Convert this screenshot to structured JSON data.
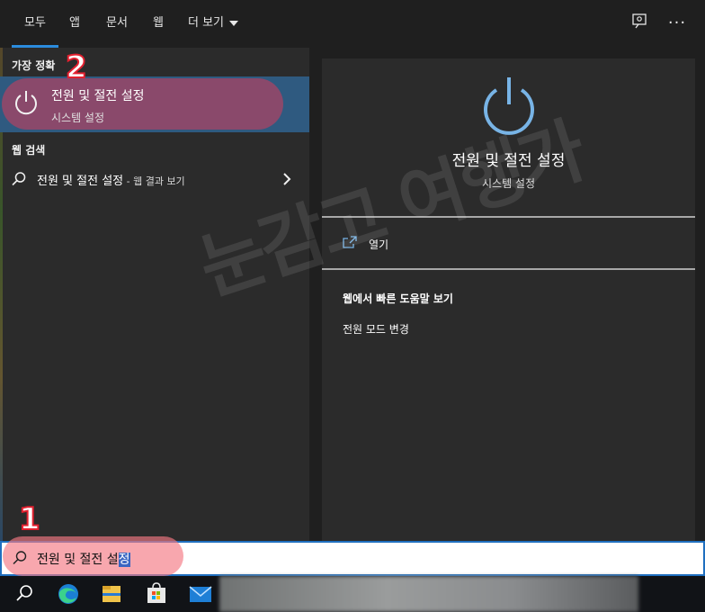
{
  "tabs": {
    "all": "모두",
    "apps": "앱",
    "documents": "문서",
    "web": "웹",
    "more": "더 보기"
  },
  "left": {
    "best_match_label": "가장 정확",
    "best_match": {
      "title": "전원 및 절전 설정",
      "subtitle": "시스템 설정"
    },
    "web_search_label": "웹 검색",
    "web_result": {
      "query": "전원 및 절전 설정",
      "suffix": " - 웹 결과 보기"
    }
  },
  "detail": {
    "title": "전원 및 절전 설정",
    "subtitle": "시스템 설정",
    "open_label": "열기",
    "help_heading": "웹에서 빠른 도움말 보기",
    "help_link": "전원 모드 변경"
  },
  "search": {
    "value_plain": "전원 및 절전 설",
    "value_selected": "정"
  },
  "annotations": {
    "badge_1": "1",
    "badge_2": "2"
  },
  "watermark": "눈감고 여행가",
  "colors": {
    "accent_blue": "#2b8bdc",
    "selection_row": "#2f5a80",
    "highlight_pink": "#d63c5a",
    "badge_red": "#e3202f",
    "power_icon_blue": "#78b4e6"
  },
  "icons": [
    "feedback-icon",
    "more-icon",
    "power-icon",
    "search-icon",
    "chevron-right-icon",
    "open-icon",
    "edge-icon",
    "file-explorer-icon",
    "store-icon",
    "mail-icon"
  ]
}
